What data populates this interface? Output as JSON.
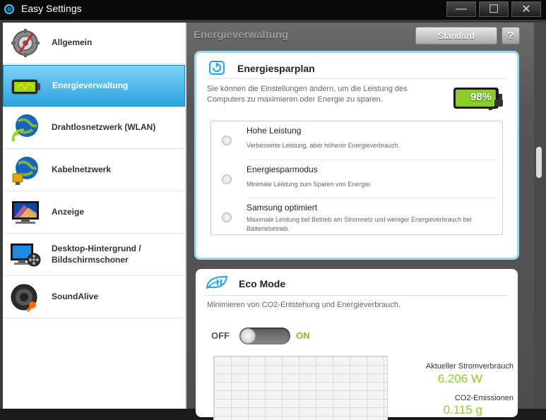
{
  "window": {
    "title": "Easy Settings",
    "minimize": "—",
    "maximize": "☐",
    "close": "✕"
  },
  "sidebar": {
    "items": [
      {
        "label": "Allgemein",
        "icon": "gear-icon"
      },
      {
        "label": "Energieverwaltung",
        "icon": "battery-icon",
        "active": true
      },
      {
        "label": "Drahtlosnetzwerk (WLAN)",
        "icon": "wifi-globe-icon"
      },
      {
        "label": "Kabelnetzwerk",
        "icon": "ethernet-globe-icon"
      },
      {
        "label": "Anzeige",
        "icon": "monitor-icon"
      },
      {
        "label": "Desktop-Hintergrund / Bildschirmschoner",
        "line1": "Desktop-Hintergrund /",
        "line2": "Bildschirmschoner",
        "icon": "desktop-film-icon"
      },
      {
        "label": "SoundAlive",
        "icon": "speaker-icon"
      }
    ]
  },
  "main": {
    "section_title": "Energieverwaltung",
    "standard_button": "Standard",
    "help_button": "?"
  },
  "power_plan": {
    "title": "Energiesparplan",
    "desc_line1": "Sie können die Einstellungen ändern, um die Leistung des",
    "desc_line2": "Computers zu maximieren oder Energie zu sparen.",
    "battery_percent": "98%",
    "battery_level": 0.98,
    "options": [
      {
        "title": "Hohe Leistung",
        "desc": "Verbesserte Leistung, aber höherer Energieverbrauch."
      },
      {
        "title": "Energiesparmodus",
        "desc": "Minimale Leistung zum Sparen von Energie."
      },
      {
        "title": "Samsung optimiert",
        "desc": "Maximale Leistung bei Betrieb am Stromnetz und weniger Energieverbrauch bei Batteriebetrieb."
      }
    ]
  },
  "eco_mode": {
    "title": "Eco Mode",
    "desc": "Minimieren von CO2-Entstehung und Energieverbrauch.",
    "toggle_off": "OFF",
    "toggle_on": "ON",
    "power_label": "Aktueller Stromverbrauch",
    "power_value": "6.206 W",
    "co2_label": "CO2-Emissionen",
    "co2_value": "0.115 g"
  },
  "colors": {
    "accent": "#29a3df",
    "green": "#8ccd2c"
  }
}
